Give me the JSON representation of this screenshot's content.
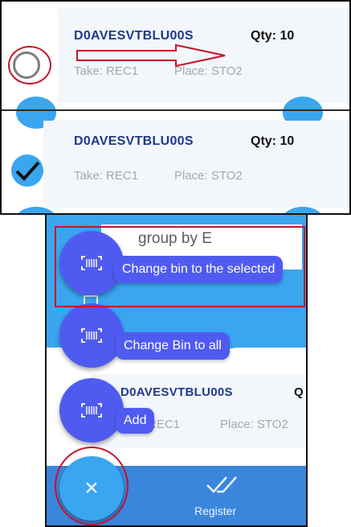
{
  "top_panel": {
    "row_unchecked": {
      "sku": "D0AVESVTBLU00S",
      "qty": "Qty: 10",
      "take": "Take: REC1",
      "place": "Place: STO2"
    },
    "row_checked": {
      "sku": "D0AVESVTBLU00S",
      "qty": "Qty: 10",
      "take": "Take: REC1",
      "place": "Place: STO2"
    }
  },
  "bottom_panel": {
    "search_text": "group by E",
    "speed_dial": {
      "change_selected_label": "Change bin to the selected",
      "change_all_label": "Change Bin to all",
      "add_label": "Add"
    },
    "row": {
      "sku": "D0AVESVTBLU00S",
      "qty_partial": "Q",
      "take_partial": "REC1",
      "place": "Place: STO2"
    },
    "bottom_bar": {
      "register_label": "Register"
    },
    "close_glyph": "×"
  },
  "colors": {
    "accent_blue": "#3aa6ef",
    "fab_purple": "#4f5bf0",
    "highlight_red": "#c4142a",
    "sku_blue": "#1e3a8a"
  }
}
